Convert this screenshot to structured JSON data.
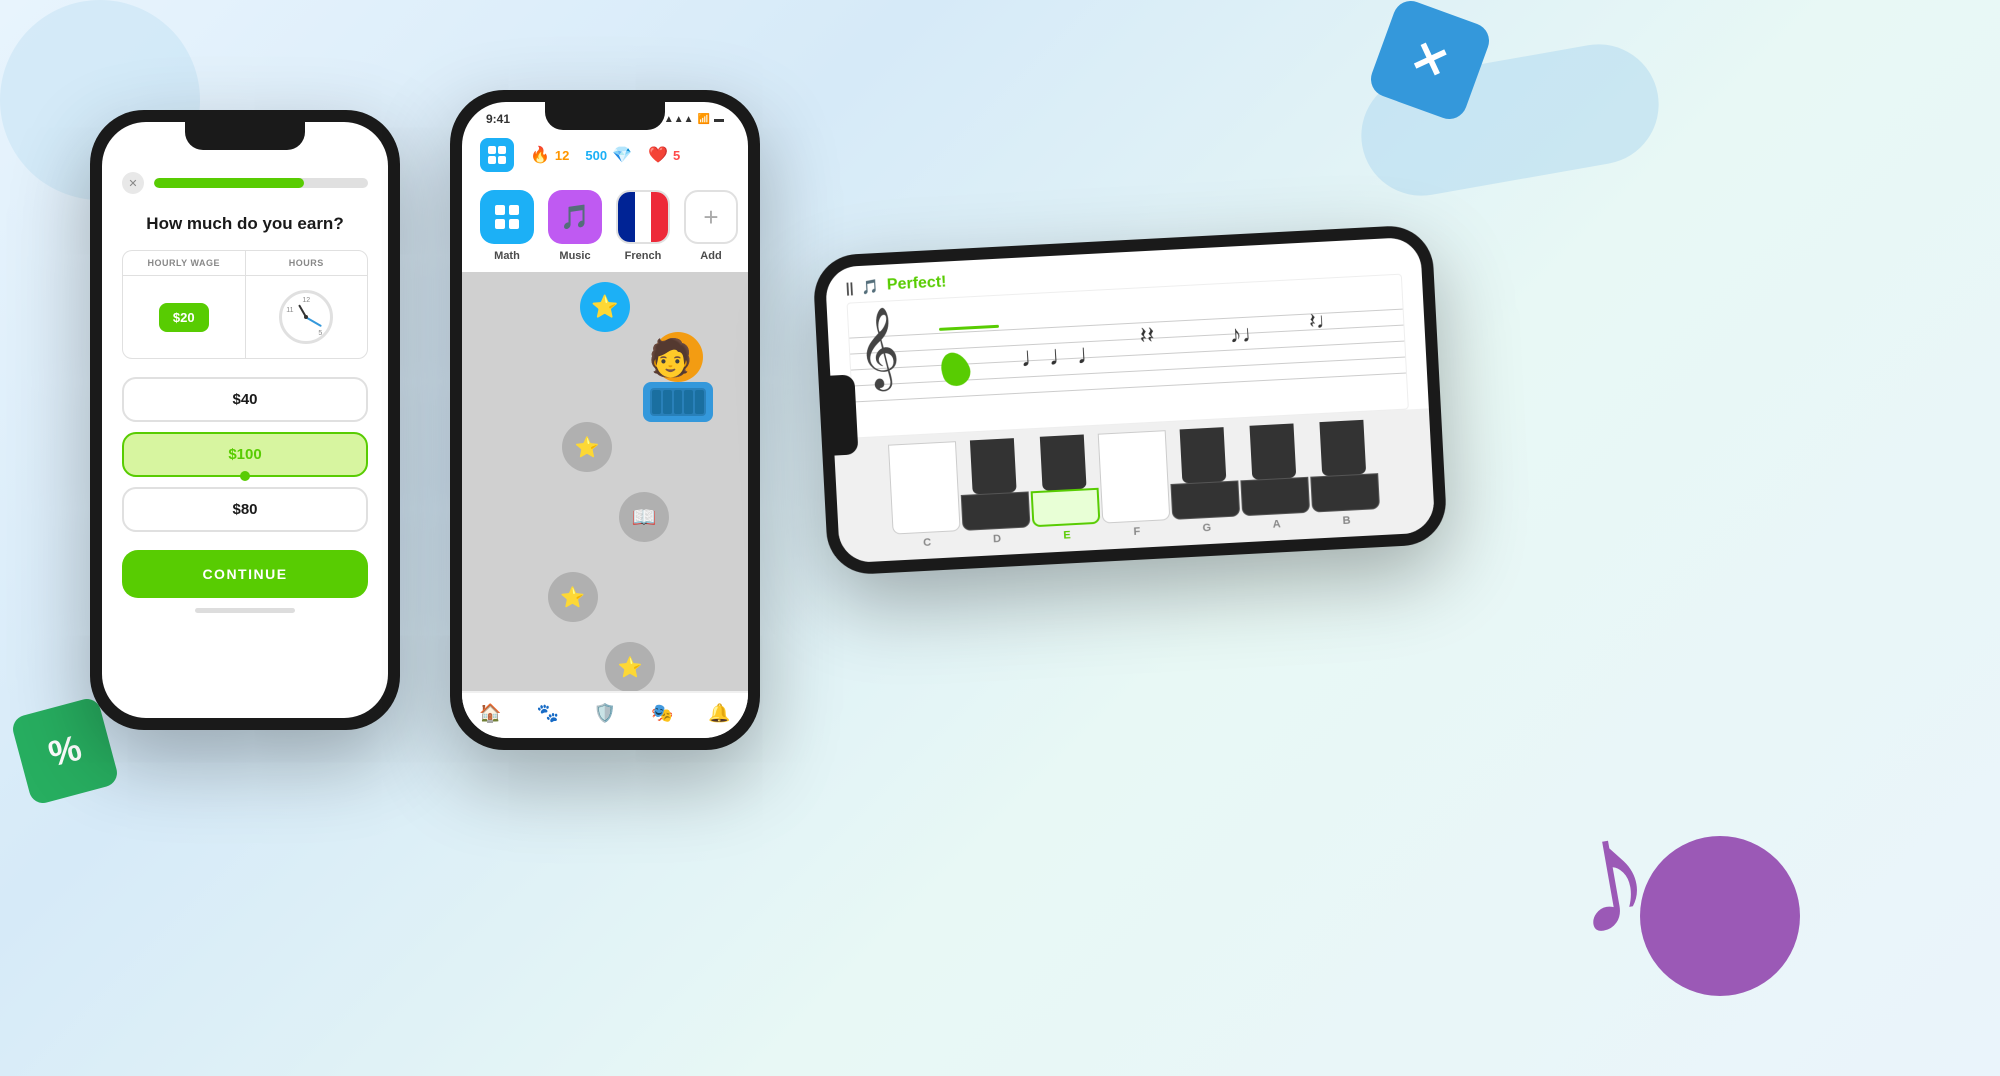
{
  "background": {
    "color": "#d6eaf8"
  },
  "phone1": {
    "question": "How much do you earn?",
    "table": {
      "col1_header": "HOURLY WAGE",
      "col2_header": "HOURS",
      "wage_value": "$20",
      "hours_label": "clock"
    },
    "options": [
      {
        "value": "$40",
        "selected": false
      },
      {
        "value": "$100",
        "selected": true
      },
      {
        "value": "$80",
        "selected": false
      }
    ],
    "continue_label": "CONTINUE",
    "progress": 70
  },
  "phone2": {
    "status_time": "9:41",
    "stats": [
      {
        "icon": "🔥",
        "value": "12",
        "color": "orange"
      },
      {
        "icon": "💎",
        "value": "500",
        "color": "blue"
      },
      {
        "icon": "❤️",
        "value": "5",
        "color": "red"
      }
    ],
    "courses": [
      {
        "id": "math",
        "label": "Math",
        "icon": "grid"
      },
      {
        "id": "music",
        "label": "Music",
        "icon": "🎵"
      },
      {
        "id": "french",
        "label": "French",
        "icon": "flag"
      },
      {
        "id": "add",
        "label": "Add",
        "icon": "+"
      }
    ],
    "nav_items": [
      "🏠",
      "🐾",
      "🛡️",
      "🎭",
      "🔔"
    ]
  },
  "phone3": {
    "status": "Perfect!",
    "piano_keys": [
      {
        "note": "C",
        "black_before": false
      },
      {
        "note": "D",
        "black_before": true
      },
      {
        "note": "E",
        "black_before": true,
        "highlighted": true
      },
      {
        "note": "F",
        "black_before": false
      },
      {
        "note": "G",
        "black_before": true
      },
      {
        "note": "A",
        "black_before": true
      },
      {
        "note": "B",
        "black_before": true
      }
    ]
  },
  "decorations": {
    "cube_symbol": "✕",
    "dice_symbol": "%",
    "music_note": "♪"
  }
}
